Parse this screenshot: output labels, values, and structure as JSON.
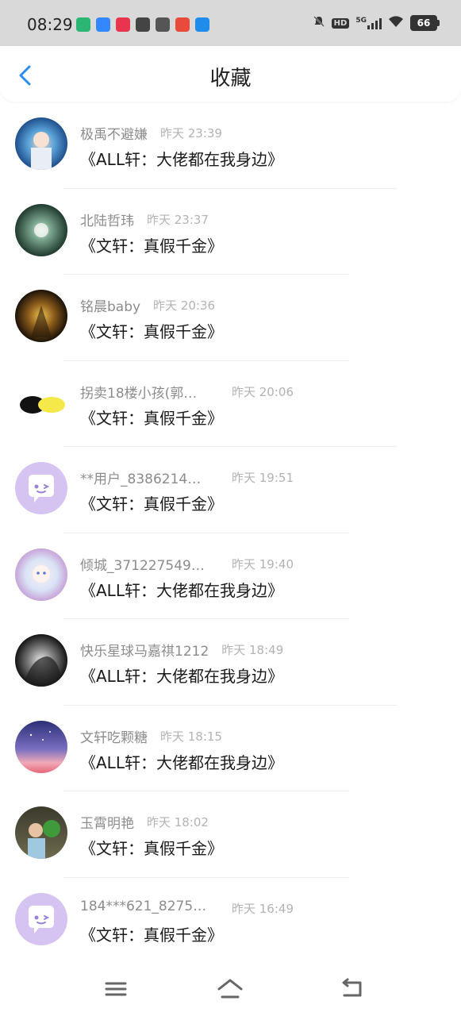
{
  "status": {
    "time": "08:29",
    "network": "5G",
    "hd": "HD",
    "battery": "66",
    "apps": [
      {
        "name": "play-app-icon",
        "color": "#2bb673"
      },
      {
        "name": "baidu-app-icon",
        "color": "#3388ff"
      },
      {
        "name": "red-app-icon",
        "color": "#e8344e"
      },
      {
        "name": "compass-app-icon",
        "color": "#444444"
      },
      {
        "name": "chat-app-icon",
        "color": "#555555"
      },
      {
        "name": "map-pin-app-icon",
        "color": "#e84a3c"
      },
      {
        "name": "blue-circle-app-icon",
        "color": "#1f8ceb"
      }
    ]
  },
  "header": {
    "title": "收藏",
    "accent": "#2a8cf0"
  },
  "items": [
    {
      "name": "极禹不避嫌",
      "time": "昨天 23:39",
      "work": "《ALL轩：大佬都在我身边》",
      "avatar": "photo-blue"
    },
    {
      "name": "北陆哲玮",
      "time": "昨天 23:37",
      "work": "《文轩：真假千金》",
      "avatar": "photo-dandelion"
    },
    {
      "name": "铭晨baby",
      "time": "昨天 20:36",
      "work": "《文轩：真假千金》",
      "avatar": "photo-dark-gold"
    },
    {
      "name": "拐卖18楼小孩(郭…",
      "time": "昨天 20:06",
      "work": "《文轩：真假千金》",
      "avatar": "photo-logo"
    },
    {
      "name": "**用户_8386214…",
      "time": "昨天 19:51",
      "work": "《文轩：真假千金》",
      "avatar": "default-chat"
    },
    {
      "name": "倾城_371227549…",
      "time": "昨天 19:40",
      "work": "《ALL轩：大佬都在我身边》",
      "avatar": "photo-anime"
    },
    {
      "name": "快乐星球马嘉祺1212",
      "time": "昨天 18:49",
      "work": "《ALL轩：大佬都在我身边》",
      "avatar": "photo-bw"
    },
    {
      "name": "文轩吃颗糖",
      "time": "昨天 18:15",
      "work": "《ALL轩：大佬都在我身边》",
      "avatar": "photo-sky"
    },
    {
      "name": "玉霄明艳",
      "time": "昨天 18:02",
      "work": "《文轩：真假千金》",
      "avatar": "photo-child"
    },
    {
      "name": "184***621_8275…",
      "time": "昨天 16:49",
      "work": "《文轩：真假千金》",
      "avatar": "default-chat"
    }
  ],
  "nav": {
    "menu_icon": "menu-icon",
    "home_icon": "home-icon",
    "back_icon": "back-icon"
  }
}
